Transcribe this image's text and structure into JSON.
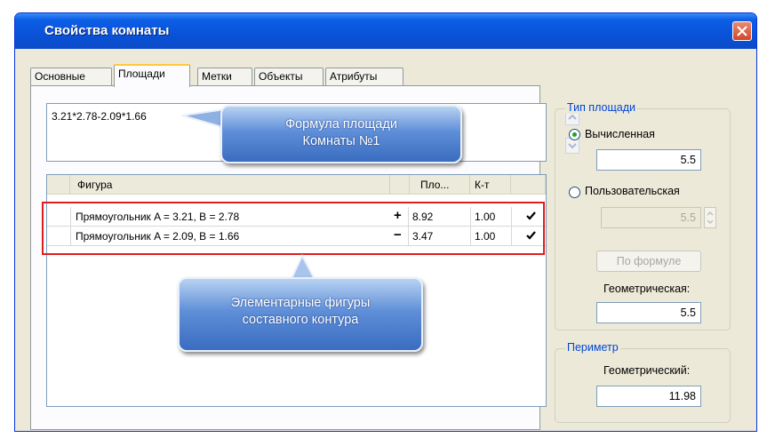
{
  "window": {
    "title": "Свойства комнаты"
  },
  "tabs": [
    "Основные",
    "Площади",
    "Метки",
    "Объекты",
    "Атрибуты"
  ],
  "formula": {
    "value": "3.21*2.78-2.09*1.66"
  },
  "table": {
    "headers": {
      "figure": "Фигура",
      "area": "Пло...",
      "coef": "К-т"
    },
    "rows": [
      {
        "figure": "Прямоугольник A = 3.21, B = 2.78",
        "sign": "+",
        "area": "8.92",
        "coef": "1.00",
        "checked": true
      },
      {
        "figure": "Прямоугольник A = 2.09, B = 1.66",
        "sign": "−",
        "area": "3.47",
        "coef": "1.00",
        "checked": true
      }
    ]
  },
  "callouts": {
    "formula": [
      "Формула площади",
      "Комнаты №1"
    ],
    "figures": [
      "Элементарные фигуры",
      "составного контура"
    ]
  },
  "area_type": {
    "group_title": "Тип площади",
    "calculated_label": "Вычисленная",
    "calculated_value": "5.5",
    "custom_label": "Пользовательская",
    "custom_value": "5.5",
    "by_formula_button": "По формуле",
    "geometric_label": "Геометрическая:",
    "geometric_value": "5.5",
    "selected": "calculated"
  },
  "perimeter": {
    "group_title": "Периметр",
    "geometric_label": "Геометрический:",
    "geometric_value": "11.98"
  },
  "colors": {
    "title_bar": "#0a52d8",
    "highlight": "#e01e1e",
    "callout": "#5f8fd8",
    "group_title": "#0046d5"
  }
}
